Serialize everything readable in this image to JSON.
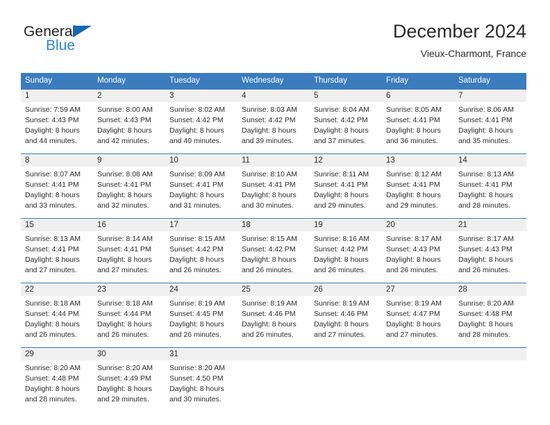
{
  "logo": {
    "word_dark": "General",
    "word_blue": "Blue",
    "triangle_color": "#1668b3",
    "blue_color": "#2e86d8"
  },
  "header": {
    "title": "December 2024",
    "subtitle": "Vieux-Charmont, France"
  },
  "theme": {
    "header_bg": "#3a7cbe",
    "header_text": "#ffffff",
    "daynum_band_bg": "#f0f0f0",
    "separator": "#3a7cbe",
    "body_text": "#2b2b2b"
  },
  "calendar": {
    "weekday_headers": [
      "Sunday",
      "Monday",
      "Tuesday",
      "Wednesday",
      "Thursday",
      "Friday",
      "Saturday"
    ],
    "weeks": [
      [
        {
          "day": "1",
          "sunrise": "Sunrise: 7:59 AM",
          "sunset": "Sunset: 4:43 PM",
          "daylight_1": "Daylight: 8 hours",
          "daylight_2": "and 44 minutes."
        },
        {
          "day": "2",
          "sunrise": "Sunrise: 8:00 AM",
          "sunset": "Sunset: 4:43 PM",
          "daylight_1": "Daylight: 8 hours",
          "daylight_2": "and 42 minutes."
        },
        {
          "day": "3",
          "sunrise": "Sunrise: 8:02 AM",
          "sunset": "Sunset: 4:42 PM",
          "daylight_1": "Daylight: 8 hours",
          "daylight_2": "and 40 minutes."
        },
        {
          "day": "4",
          "sunrise": "Sunrise: 8:03 AM",
          "sunset": "Sunset: 4:42 PM",
          "daylight_1": "Daylight: 8 hours",
          "daylight_2": "and 39 minutes."
        },
        {
          "day": "5",
          "sunrise": "Sunrise: 8:04 AM",
          "sunset": "Sunset: 4:42 PM",
          "daylight_1": "Daylight: 8 hours",
          "daylight_2": "and 37 minutes."
        },
        {
          "day": "6",
          "sunrise": "Sunrise: 8:05 AM",
          "sunset": "Sunset: 4:41 PM",
          "daylight_1": "Daylight: 8 hours",
          "daylight_2": "and 36 minutes."
        },
        {
          "day": "7",
          "sunrise": "Sunrise: 8:06 AM",
          "sunset": "Sunset: 4:41 PM",
          "daylight_1": "Daylight: 8 hours",
          "daylight_2": "and 35 minutes."
        }
      ],
      [
        {
          "day": "8",
          "sunrise": "Sunrise: 8:07 AM",
          "sunset": "Sunset: 4:41 PM",
          "daylight_1": "Daylight: 8 hours",
          "daylight_2": "and 33 minutes."
        },
        {
          "day": "9",
          "sunrise": "Sunrise: 8:08 AM",
          "sunset": "Sunset: 4:41 PM",
          "daylight_1": "Daylight: 8 hours",
          "daylight_2": "and 32 minutes."
        },
        {
          "day": "10",
          "sunrise": "Sunrise: 8:09 AM",
          "sunset": "Sunset: 4:41 PM",
          "daylight_1": "Daylight: 8 hours",
          "daylight_2": "and 31 minutes."
        },
        {
          "day": "11",
          "sunrise": "Sunrise: 8:10 AM",
          "sunset": "Sunset: 4:41 PM",
          "daylight_1": "Daylight: 8 hours",
          "daylight_2": "and 30 minutes."
        },
        {
          "day": "12",
          "sunrise": "Sunrise: 8:11 AM",
          "sunset": "Sunset: 4:41 PM",
          "daylight_1": "Daylight: 8 hours",
          "daylight_2": "and 29 minutes."
        },
        {
          "day": "13",
          "sunrise": "Sunrise: 8:12 AM",
          "sunset": "Sunset: 4:41 PM",
          "daylight_1": "Daylight: 8 hours",
          "daylight_2": "and 29 minutes."
        },
        {
          "day": "14",
          "sunrise": "Sunrise: 8:13 AM",
          "sunset": "Sunset: 4:41 PM",
          "daylight_1": "Daylight: 8 hours",
          "daylight_2": "and 28 minutes."
        }
      ],
      [
        {
          "day": "15",
          "sunrise": "Sunrise: 8:13 AM",
          "sunset": "Sunset: 4:41 PM",
          "daylight_1": "Daylight: 8 hours",
          "daylight_2": "and 27 minutes."
        },
        {
          "day": "16",
          "sunrise": "Sunrise: 8:14 AM",
          "sunset": "Sunset: 4:41 PM",
          "daylight_1": "Daylight: 8 hours",
          "daylight_2": "and 27 minutes."
        },
        {
          "day": "17",
          "sunrise": "Sunrise: 8:15 AM",
          "sunset": "Sunset: 4:42 PM",
          "daylight_1": "Daylight: 8 hours",
          "daylight_2": "and 26 minutes."
        },
        {
          "day": "18",
          "sunrise": "Sunrise: 8:15 AM",
          "sunset": "Sunset: 4:42 PM",
          "daylight_1": "Daylight: 8 hours",
          "daylight_2": "and 26 minutes."
        },
        {
          "day": "19",
          "sunrise": "Sunrise: 8:16 AM",
          "sunset": "Sunset: 4:42 PM",
          "daylight_1": "Daylight: 8 hours",
          "daylight_2": "and 26 minutes."
        },
        {
          "day": "20",
          "sunrise": "Sunrise: 8:17 AM",
          "sunset": "Sunset: 4:43 PM",
          "daylight_1": "Daylight: 8 hours",
          "daylight_2": "and 26 minutes."
        },
        {
          "day": "21",
          "sunrise": "Sunrise: 8:17 AM",
          "sunset": "Sunset: 4:43 PM",
          "daylight_1": "Daylight: 8 hours",
          "daylight_2": "and 26 minutes."
        }
      ],
      [
        {
          "day": "22",
          "sunrise": "Sunrise: 8:18 AM",
          "sunset": "Sunset: 4:44 PM",
          "daylight_1": "Daylight: 8 hours",
          "daylight_2": "and 26 minutes."
        },
        {
          "day": "23",
          "sunrise": "Sunrise: 8:18 AM",
          "sunset": "Sunset: 4:44 PM",
          "daylight_1": "Daylight: 8 hours",
          "daylight_2": "and 26 minutes."
        },
        {
          "day": "24",
          "sunrise": "Sunrise: 8:19 AM",
          "sunset": "Sunset: 4:45 PM",
          "daylight_1": "Daylight: 8 hours",
          "daylight_2": "and 26 minutes."
        },
        {
          "day": "25",
          "sunrise": "Sunrise: 8:19 AM",
          "sunset": "Sunset: 4:46 PM",
          "daylight_1": "Daylight: 8 hours",
          "daylight_2": "and 26 minutes."
        },
        {
          "day": "26",
          "sunrise": "Sunrise: 8:19 AM",
          "sunset": "Sunset: 4:46 PM",
          "daylight_1": "Daylight: 8 hours",
          "daylight_2": "and 27 minutes."
        },
        {
          "day": "27",
          "sunrise": "Sunrise: 8:19 AM",
          "sunset": "Sunset: 4:47 PM",
          "daylight_1": "Daylight: 8 hours",
          "daylight_2": "and 27 minutes."
        },
        {
          "day": "28",
          "sunrise": "Sunrise: 8:20 AM",
          "sunset": "Sunset: 4:48 PM",
          "daylight_1": "Daylight: 8 hours",
          "daylight_2": "and 28 minutes."
        }
      ],
      [
        {
          "day": "29",
          "sunrise": "Sunrise: 8:20 AM",
          "sunset": "Sunset: 4:48 PM",
          "daylight_1": "Daylight: 8 hours",
          "daylight_2": "and 28 minutes."
        },
        {
          "day": "30",
          "sunrise": "Sunrise: 8:20 AM",
          "sunset": "Sunset: 4:49 PM",
          "daylight_1": "Daylight: 8 hours",
          "daylight_2": "and 29 minutes."
        },
        {
          "day": "31",
          "sunrise": "Sunrise: 8:20 AM",
          "sunset": "Sunset: 4:50 PM",
          "daylight_1": "Daylight: 8 hours",
          "daylight_2": "and 30 minutes."
        },
        {
          "day": "",
          "sunrise": "",
          "sunset": "",
          "daylight_1": "",
          "daylight_2": ""
        },
        {
          "day": "",
          "sunrise": "",
          "sunset": "",
          "daylight_1": "",
          "daylight_2": ""
        },
        {
          "day": "",
          "sunrise": "",
          "sunset": "",
          "daylight_1": "",
          "daylight_2": ""
        },
        {
          "day": "",
          "sunrise": "",
          "sunset": "",
          "daylight_1": "",
          "daylight_2": ""
        }
      ]
    ]
  }
}
